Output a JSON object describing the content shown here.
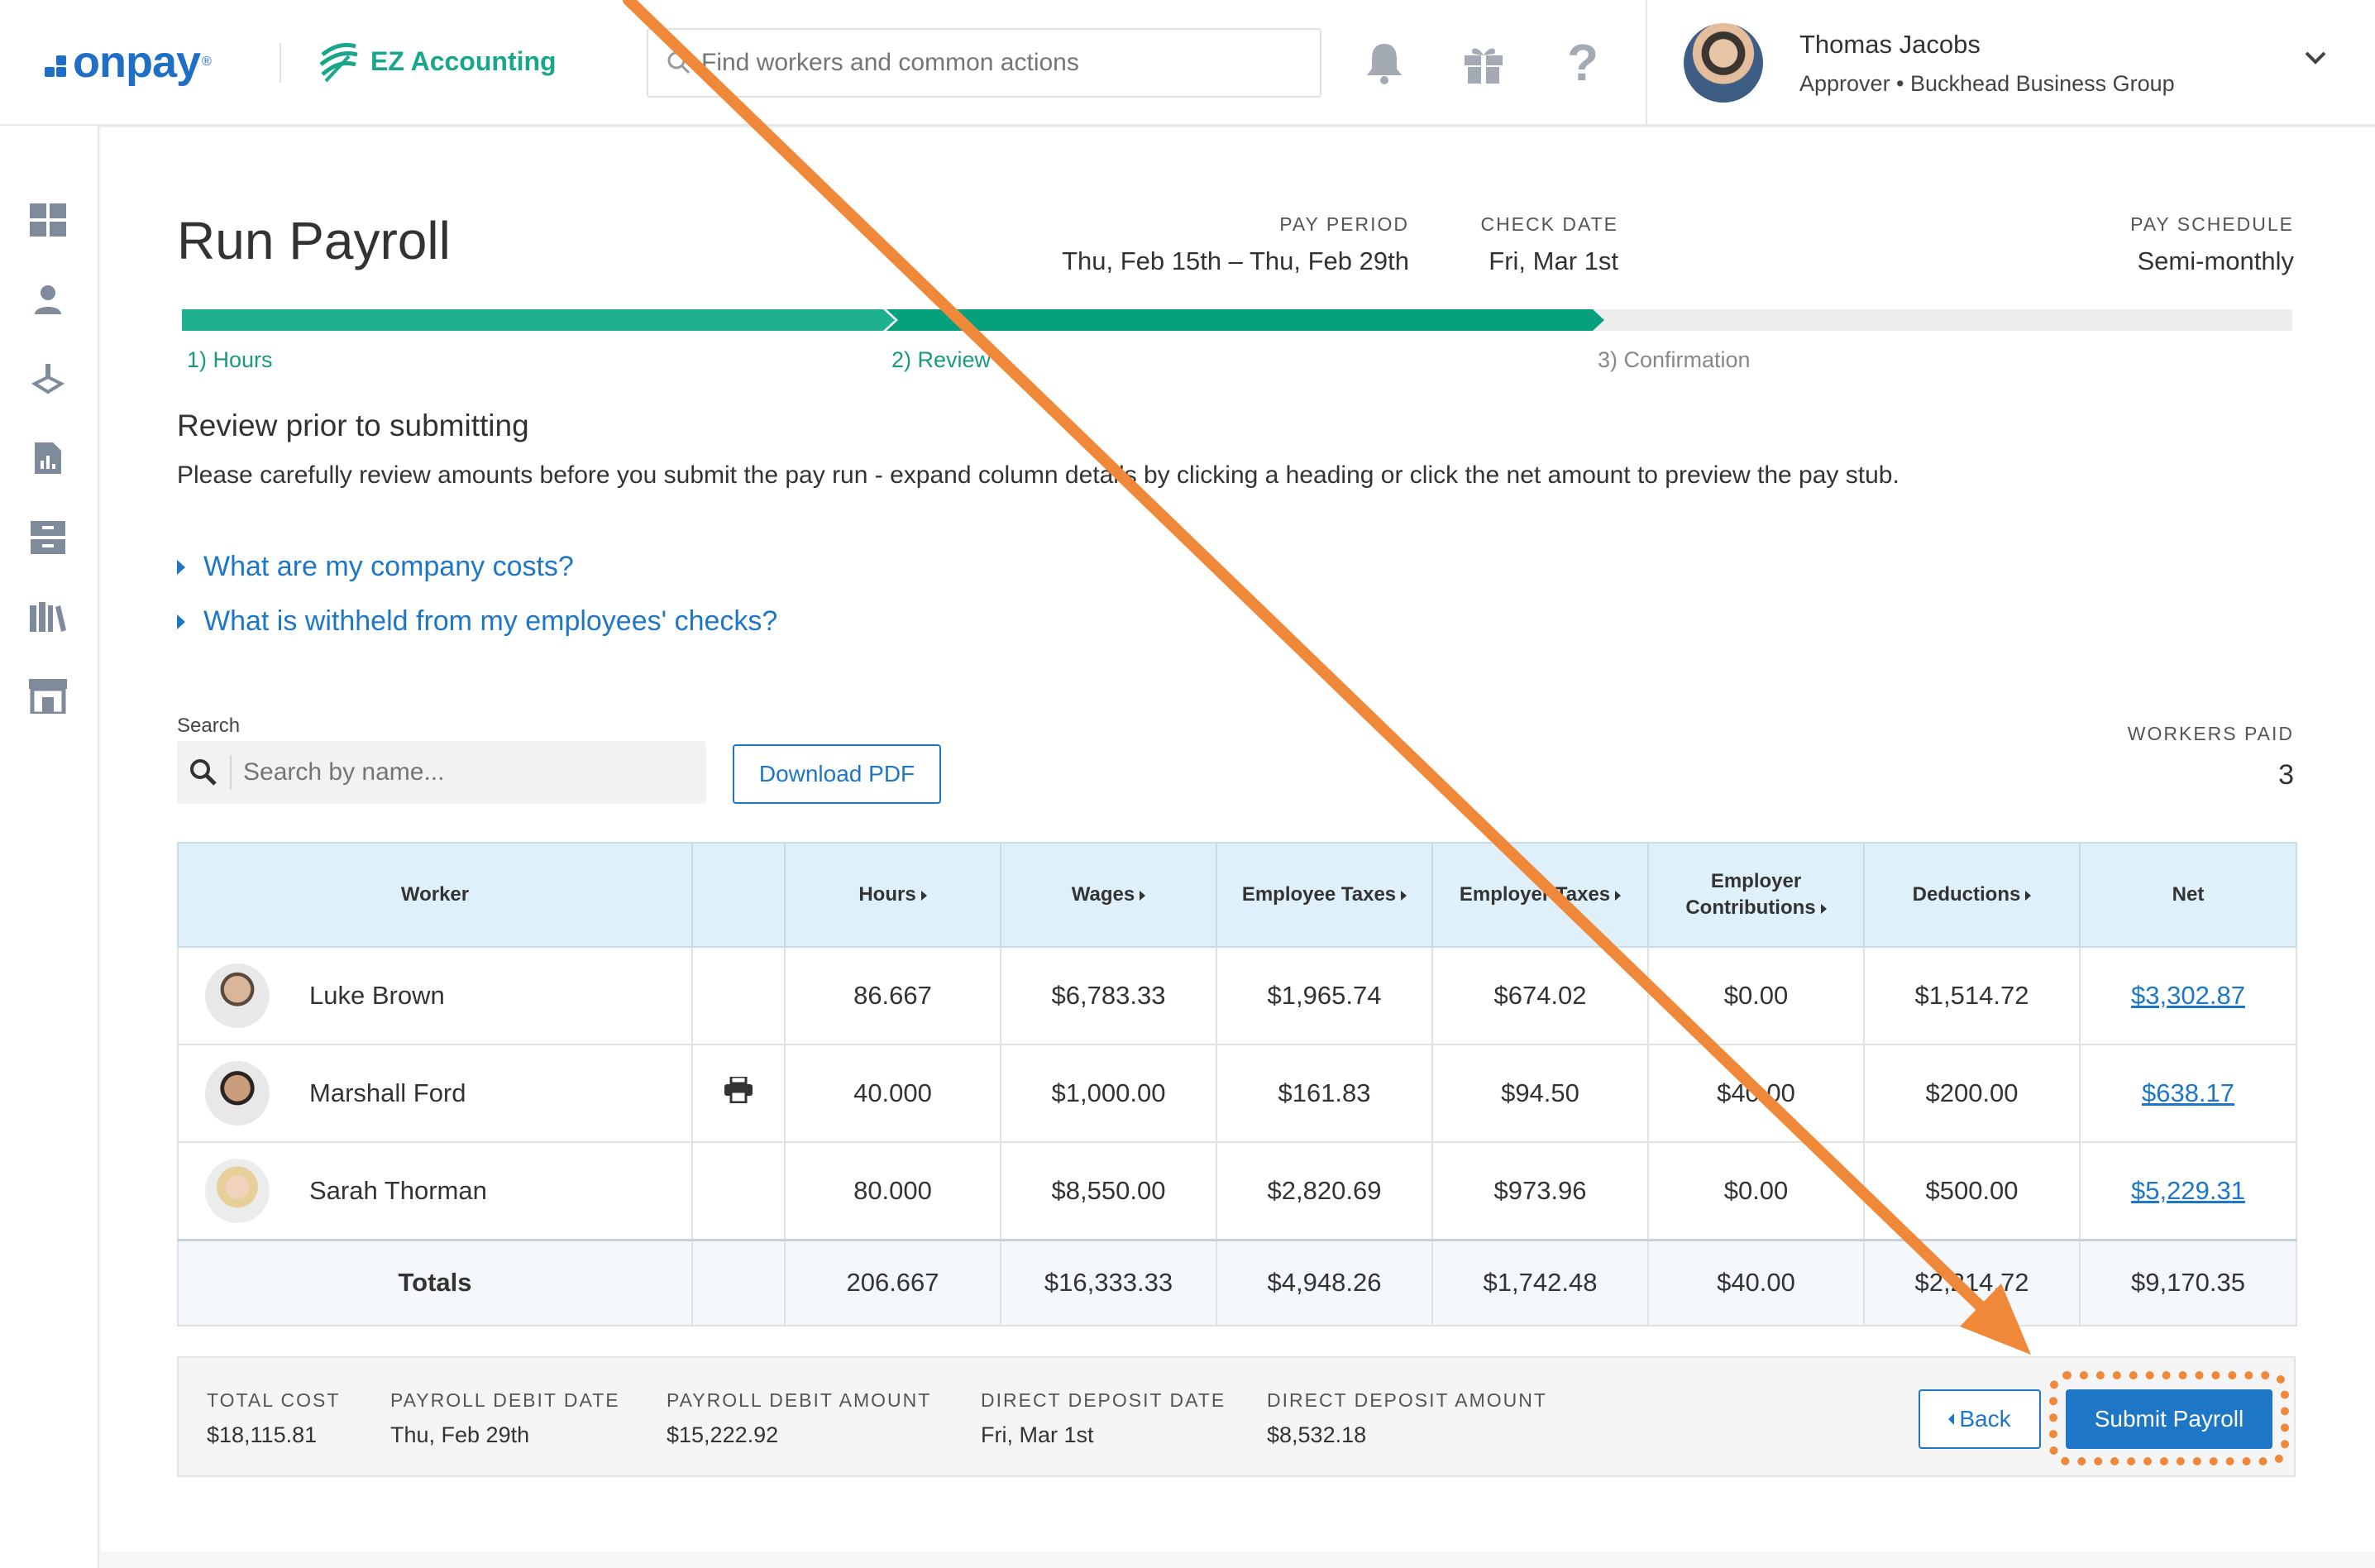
{
  "header": {
    "logo": "onpay",
    "logo_mark": "®",
    "partner_logo": "EZ Accounting",
    "search_placeholder": "Find workers and common actions",
    "icons": [
      "bell-icon",
      "gift-icon",
      "help-icon"
    ],
    "user": {
      "name": "Thomas Jacobs",
      "role": "Approver • Buckhead Business Group"
    }
  },
  "sidebar": {
    "icons": [
      "dashboard-icon",
      "people-icon",
      "payroll-hand-icon",
      "reports-icon",
      "filing-cabinet-icon",
      "library-icon",
      "store-icon"
    ]
  },
  "page": {
    "title": "Run Payroll",
    "pay_period_label": "PAY PERIOD",
    "pay_period_value": "Thu, Feb 15th – Thu, Feb 29th",
    "check_date_label": "CHECK DATE",
    "check_date_value": "Fri, Mar 1st",
    "pay_schedule_label": "PAY SCHEDULE",
    "pay_schedule_value": "Semi-monthly"
  },
  "steps": [
    {
      "label": "1) Hours",
      "state": "done"
    },
    {
      "label": "2) Review",
      "state": "current"
    },
    {
      "label": "3) Confirmation",
      "state": "todo"
    }
  ],
  "review": {
    "title": "Review prior to submitting",
    "description": "Please carefully review amounts before you submit the pay run - expand column details by clicking a heading or click the net amount to preview the pay stub.",
    "faq": [
      "What are my company costs?",
      "What is withheld from my employees' checks?"
    ]
  },
  "search": {
    "label": "Search",
    "placeholder": "Search by name...",
    "download_label": "Download PDF",
    "workers_paid_label": "WORKERS PAID",
    "workers_paid_value": "3"
  },
  "table": {
    "headers": {
      "worker": "Worker",
      "hours": "Hours",
      "wages": "Wages",
      "employee_taxes": "Employee Taxes",
      "employer_taxes": "Employer Taxes",
      "employer_contributions_1": "Employer",
      "employer_contributions_2": "Contributions",
      "deductions": "Deductions",
      "net": "Net"
    },
    "rows": [
      {
        "name": "Luke Brown",
        "hours": "86.667",
        "wages": "$6,783.33",
        "employee_taxes": "$1,965.74",
        "employer_taxes": "$674.02",
        "contributions": "$0.00",
        "deductions": "$1,514.72",
        "net": "$3,302.87"
      },
      {
        "name": "Marshall Ford",
        "hours": "40.000",
        "wages": "$1,000.00",
        "employee_taxes": "$161.83",
        "employer_taxes": "$94.50",
        "contributions": "$40.00",
        "deductions": "$200.00",
        "net": "$638.17"
      },
      {
        "name": "Sarah Thorman",
        "hours": "80.000",
        "wages": "$8,550.00",
        "employee_taxes": "$2,820.69",
        "employer_taxes": "$973.96",
        "contributions": "$0.00",
        "deductions": "$500.00",
        "net": "$5,229.31"
      }
    ],
    "totals": {
      "label": "Totals",
      "hours": "206.667",
      "wages": "$16,333.33",
      "employee_taxes": "$4,948.26",
      "employer_taxes": "$1,742.48",
      "contributions": "$40.00",
      "deductions": "$2,214.72",
      "net": "$9,170.35"
    }
  },
  "summary": {
    "total_cost_label": "TOTAL COST",
    "total_cost_value": "$18,115.81",
    "debit_date_label": "PAYROLL DEBIT DATE",
    "debit_date_value": "Thu, Feb 29th",
    "debit_amount_label": "PAYROLL DEBIT AMOUNT",
    "debit_amount_value": "$15,222.92",
    "dd_date_label": "DIRECT DEPOSIT DATE",
    "dd_date_value": "Fri, Mar 1st",
    "dd_amount_label": "DIRECT DEPOSIT AMOUNT",
    "dd_amount_value": "$8,532.18",
    "back_label": "Back",
    "submit_label": "Submit Payroll"
  },
  "colors": {
    "brand_blue": "#1f6fc5",
    "link_blue": "#1e76c7",
    "step_done": "#1fb08f",
    "step_current": "#06a07d",
    "annotation_orange": "#f0883a"
  }
}
